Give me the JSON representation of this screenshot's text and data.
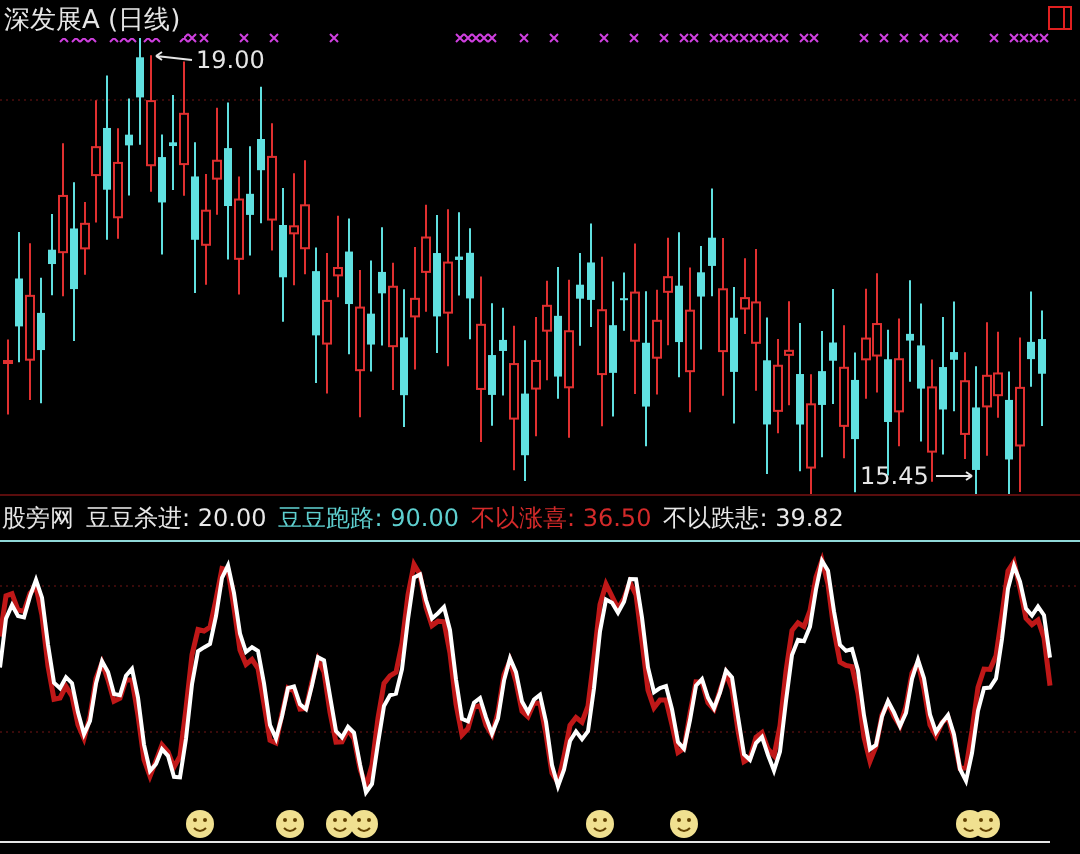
{
  "chart_title": "深发展A (日线)",
  "price_labels": [
    {
      "kind": "high",
      "text": "19.00"
    },
    {
      "kind": "low",
      "text": "15.45"
    }
  ],
  "indicator": {
    "name": "股旁网",
    "values": [
      {
        "label": "豆豆杀进:",
        "value": "20.00",
        "color": "#e8e8e8"
      },
      {
        "label": "豆豆跑路:",
        "value": "90.00",
        "color": "#5ecfcf"
      },
      {
        "label": "不以涨喜:",
        "value": "36.50",
        "color": "#d42a2a"
      },
      {
        "label": "不以跌悲:",
        "value": "39.82",
        "color": "#e8e8e8"
      }
    ]
  }
}
